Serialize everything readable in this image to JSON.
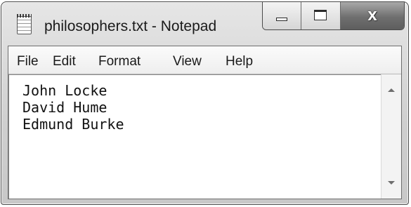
{
  "window": {
    "title": "philosophers.txt - Notepad",
    "icon": "notepad-icon"
  },
  "controls": {
    "minimize_icon": "minimize-icon",
    "maximize_icon": "maximize-icon",
    "close_icon": "close-icon",
    "close_glyph": "x"
  },
  "menubar": {
    "items": [
      {
        "label": "File"
      },
      {
        "label": "Edit"
      },
      {
        "label": "Format"
      },
      {
        "label": "View"
      },
      {
        "label": "Help"
      }
    ]
  },
  "editor": {
    "lines": [
      "John Locke",
      "David Hume",
      "Edmund Burke"
    ]
  },
  "scrollbar": {
    "up_icon": "scroll-up-arrow-icon",
    "down_icon": "scroll-down-arrow-icon"
  }
}
